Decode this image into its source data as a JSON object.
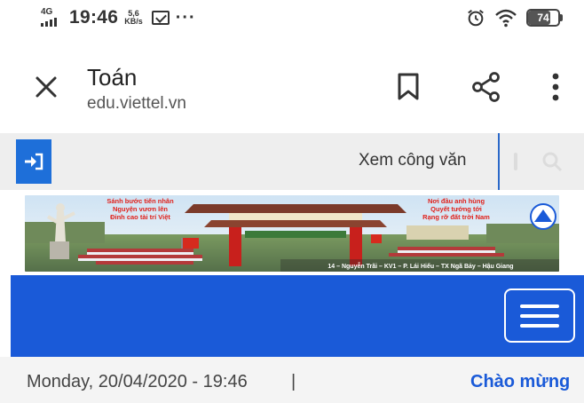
{
  "status_bar": {
    "network": "4G",
    "time": "19:46",
    "speed_value": "5,6",
    "speed_unit": "KB/s",
    "more": "···",
    "battery": "74",
    "battery_fraction": 0.74
  },
  "browser": {
    "title": "Toán",
    "url": "edu.viettel.vn"
  },
  "site": {
    "top_link": "Xem công văn",
    "banner": {
      "left_slogan": [
        "Sánh bước tiến nhân",
        "Nguyện vươn lên",
        "Đỉnh cao tài trí Việt"
      ],
      "right_slogan": [
        "Nơi đầu anh hùng",
        "Quyết tướng tới",
        "Rạng rỡ đất trời Nam"
      ],
      "address": "14 – Nguyễn Trãi – KV1 – P. Lái Hiếu – TX Ngã Bảy – Hậu Giang"
    },
    "date": "Monday, 20/04/2020 - 19:46",
    "date_separator": "|",
    "welcome": "Chào mừng"
  },
  "colors": {
    "accent_blue": "#1a5ad8",
    "login_blue": "#1e6fd9",
    "slogan_red": "#e0201a"
  }
}
